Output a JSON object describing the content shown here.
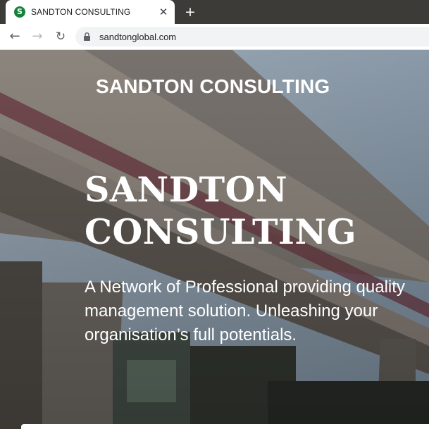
{
  "browser": {
    "tab": {
      "title": "SANDTON CONSULTING",
      "favicon_letter": "S",
      "close_glyph": "✕"
    },
    "new_tab_glyph": "+",
    "toolbar": {
      "back_glyph": "←",
      "forward_glyph": "→",
      "reload_glyph": "↻"
    },
    "address_bar": {
      "url": "sandtonglobal.com",
      "secure": true
    }
  },
  "site": {
    "logo_text": "SANDTON CONSULTING",
    "hero": {
      "title_line1": "SANDTON",
      "title_line2": "CONSULTING",
      "subtitle": "A Network of Professional providing quality management solution. Unleashing your organisation’s full potentials."
    }
  },
  "colors": {
    "tab_strip": "#3c3b37",
    "favicon": "#17803a",
    "hero_text": "#ffffff"
  },
  "icons": {
    "favicon": "sandton-logo-icon",
    "close": "close-icon",
    "new_tab": "plus-icon",
    "back": "back-arrow-icon",
    "forward": "forward-arrow-icon",
    "reload": "reload-icon",
    "lock": "lock-icon"
  }
}
